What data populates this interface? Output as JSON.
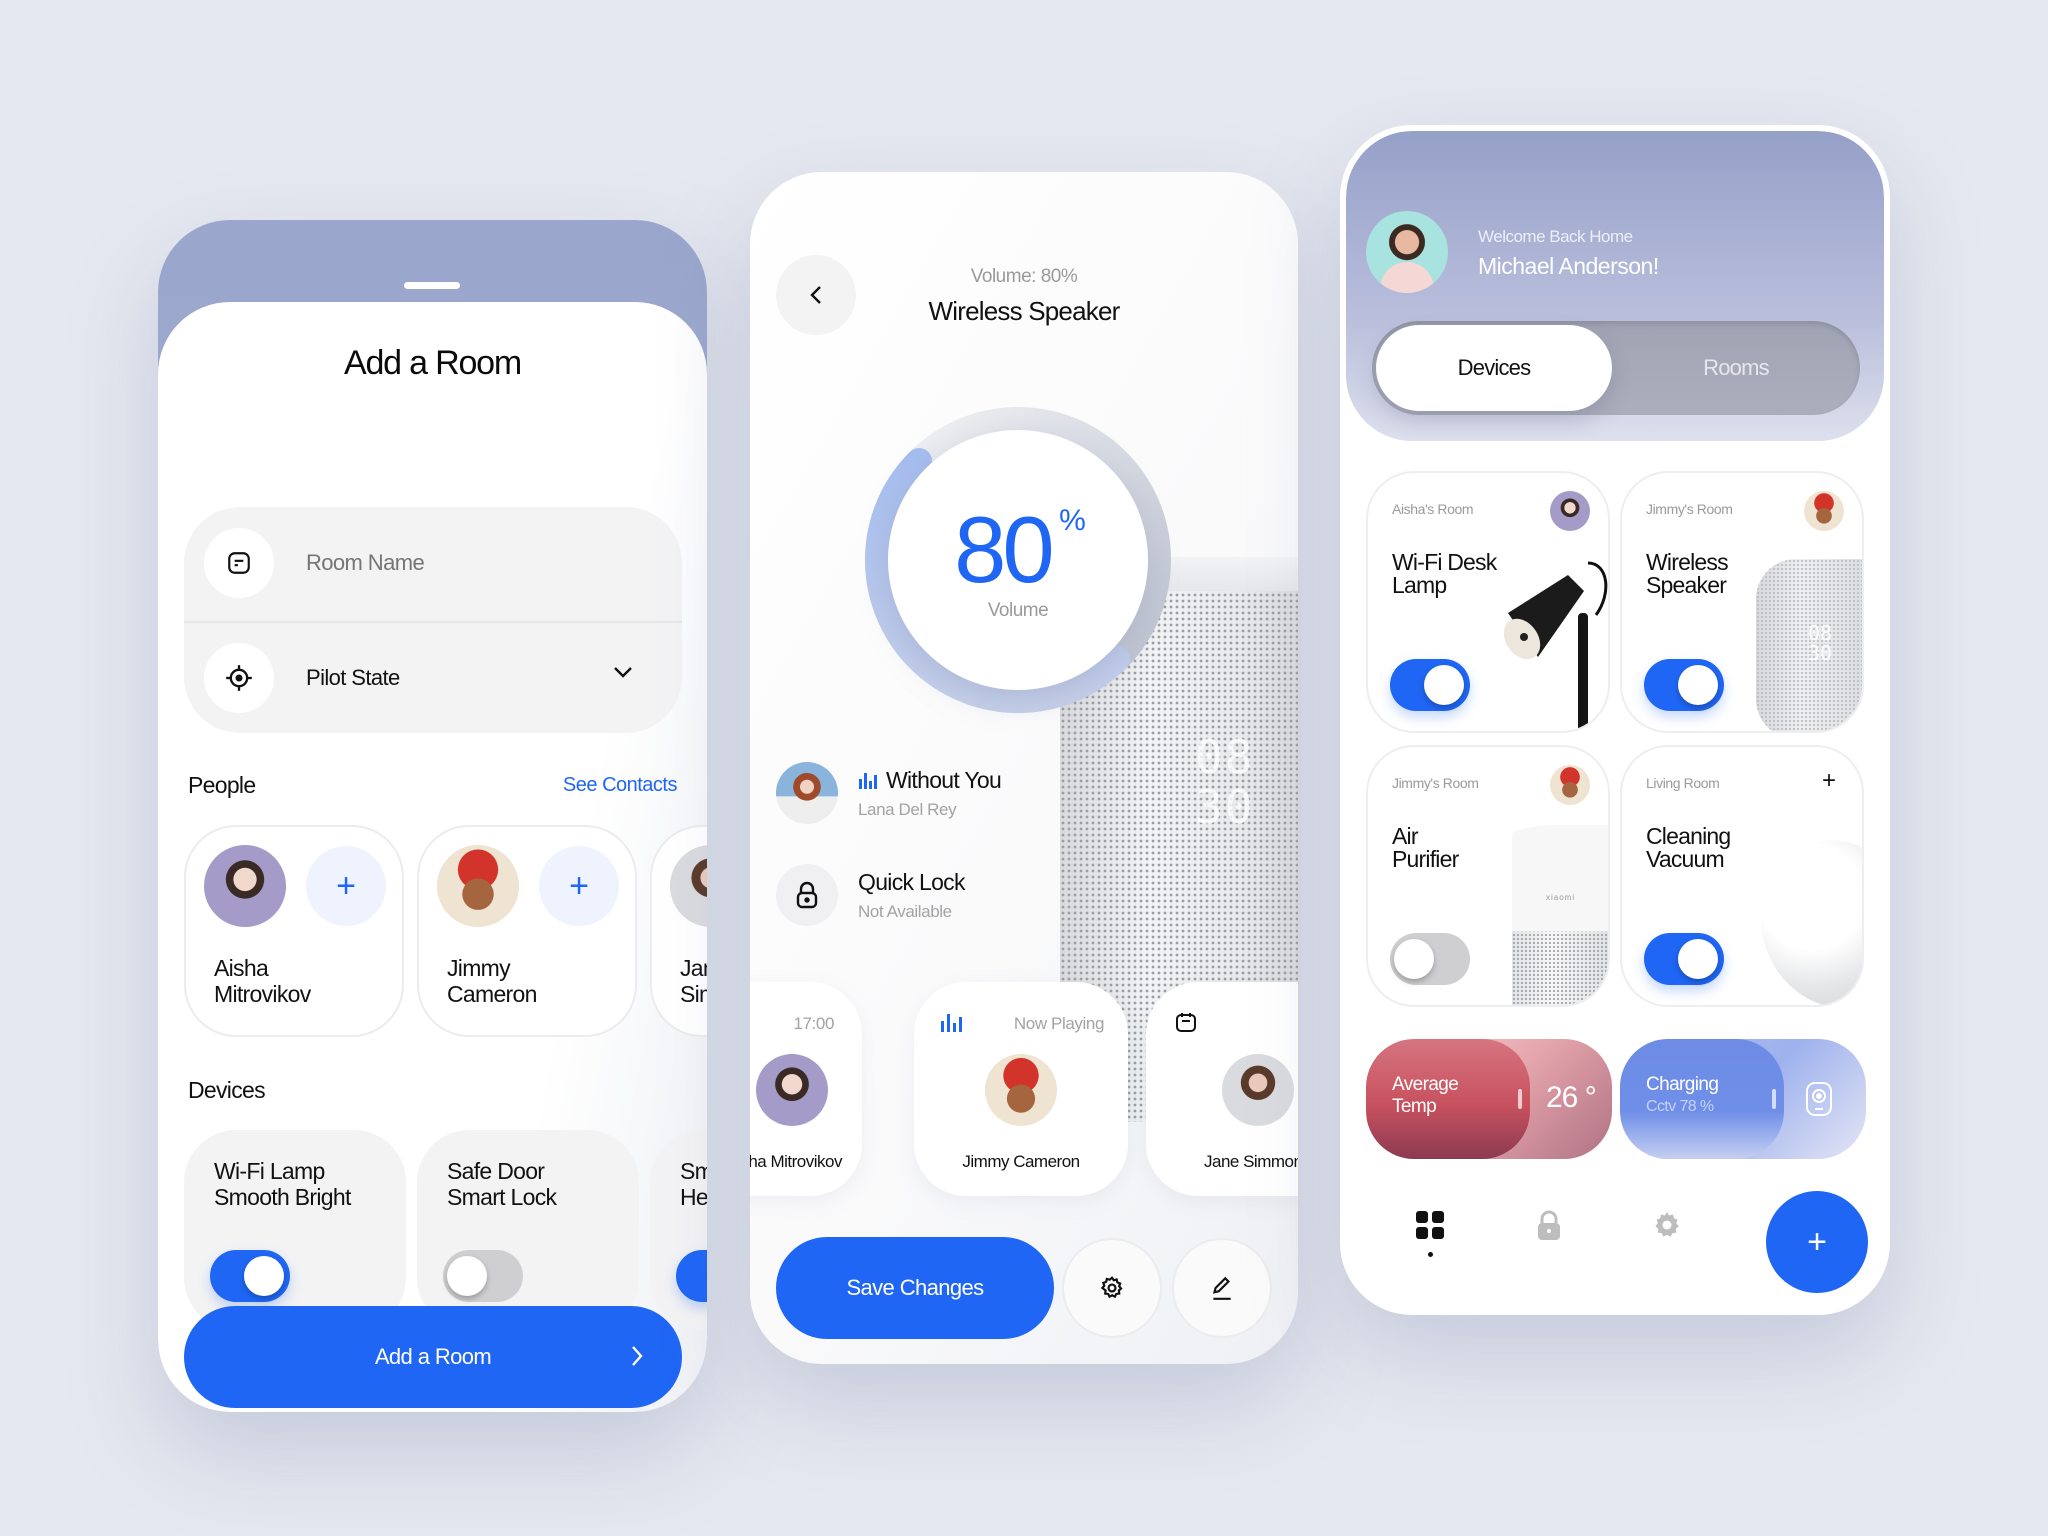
{
  "add_room_screen": {
    "title": "Add a Room",
    "room_name_placeholder": "Room Name",
    "room_name_value": "",
    "state_select_value": "Pilot State",
    "people_label": "People",
    "see_contacts_label": "See Contacts",
    "people": [
      {
        "first": "Aisha",
        "last": "Mitrovikov",
        "avatar": "aisha-photo"
      },
      {
        "first": "Jimmy",
        "last": "Cameron",
        "avatar": "jimmy-3d-avatar"
      },
      {
        "first": "Jane",
        "last": "Simmons",
        "avatar": "jane-photo"
      }
    ],
    "devices_label": "Devices",
    "devices": [
      {
        "line1": "Wi-Fi Lamp",
        "line2": "Smooth Bright",
        "on": true
      },
      {
        "line1": "Safe Door",
        "line2": "Smart Lock",
        "on": false
      },
      {
        "line1": "Smart",
        "line2": "Heater",
        "on": true
      }
    ],
    "add_button_label": "Add a Room"
  },
  "speaker_screen": {
    "subtitle": "Volume: 80%",
    "title": "Wireless Speaker",
    "volume_value": "80",
    "volume_unit": "%",
    "volume_fraction": 0.8,
    "volume_caption": "Volume",
    "clock_display": [
      "08",
      "30"
    ],
    "now_playing": {
      "song": "Without You",
      "artist": "Lana Del Rey"
    },
    "quick_lock": {
      "title": "Quick Lock",
      "status": "Not Available"
    },
    "listener_cards": [
      {
        "header": "17:00",
        "name": "Aisha Mitrovikov",
        "header_icon": ""
      },
      {
        "header": "Now Playing",
        "name": "Jimmy Cameron",
        "header_icon": "equalizer-icon"
      },
      {
        "header": "",
        "name": "Jane Simmons",
        "header_icon": "calendar-icon"
      }
    ],
    "save_button_label": "Save Changes"
  },
  "dashboard_screen": {
    "welcome_sub": "Welcome Back Home",
    "user_name": "Michael Anderson!",
    "tabs": [
      {
        "label": "Devices",
        "active": true
      },
      {
        "label": "Rooms",
        "active": false
      }
    ],
    "device_cards": [
      {
        "room": "Aisha's Room",
        "name_line1": "Wi-Fi Desk",
        "name_line2": "Lamp",
        "on": true,
        "owner": "aisha"
      },
      {
        "room": "Jimmy's Room",
        "name_line1": "Wireless",
        "name_line2": "Speaker",
        "on": true,
        "owner": "jimmy"
      },
      {
        "room": "Jimmy's Room",
        "name_line1": "Air",
        "name_line2": "Purifier",
        "on": false,
        "owner": "jimmy",
        "brand_text": "xiaomi"
      },
      {
        "room": "Living Room",
        "name_line1": "Cleaning",
        "name_line2": "Vacuum",
        "on": true,
        "owner": ""
      }
    ],
    "temp_pill": {
      "line1": "Average",
      "line2": "Temp",
      "value": "26 °"
    },
    "charging_pill": {
      "title": "Charging",
      "sub": "Cctv 78 %"
    },
    "bottom_nav": [
      "grid-icon",
      "lock-icon",
      "gear-icon"
    ],
    "fab_label": "+"
  },
  "colors": {
    "accent": "#1f66f5",
    "background": "#e5e8f0",
    "header_lavender": "#9aa6cc",
    "temp_red": "#c8515e",
    "charge_blue": "#6d8ce6"
  }
}
